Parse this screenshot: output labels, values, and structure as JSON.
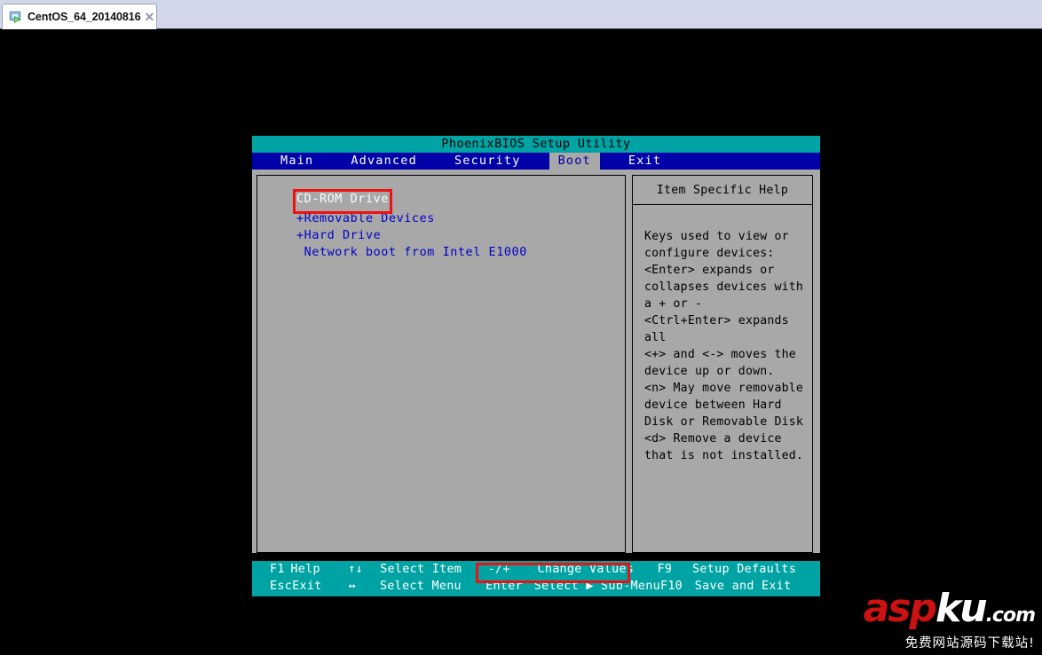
{
  "tab": {
    "title": "CentOS_64_20140816",
    "close_label": "✕",
    "icon": "virtual-machine-icon"
  },
  "bios": {
    "title": "PhoenixBIOS Setup Utility",
    "menu": [
      {
        "label": "Main",
        "selected": false
      },
      {
        "label": "Advanced",
        "selected": false
      },
      {
        "label": "Security",
        "selected": false
      },
      {
        "label": "Boot",
        "selected": true
      },
      {
        "label": "Exit",
        "selected": false
      }
    ],
    "boot_order": [
      {
        "label": "CD-ROM Drive",
        "selected": true,
        "expandable": false
      },
      {
        "label": "+Removable Devices",
        "selected": false,
        "expandable": true
      },
      {
        "label": "+Hard Drive",
        "selected": false,
        "expandable": true
      },
      {
        "label": " Network boot from Intel E1000",
        "selected": false,
        "expandable": false
      }
    ],
    "help": {
      "title": "Item Specific Help",
      "lines": [
        "Keys used to view or",
        "configure devices:",
        "<Enter> expands or",
        "collapses devices with",
        "a + or -",
        "<Ctrl+Enter> expands",
        "all",
        "<+> and <-> moves the",
        "device up or down.",
        "<n> May move removable",
        "device between Hard",
        "Disk or Removable Disk",
        "<d> Remove a device",
        "that is not installed."
      ]
    },
    "footer": {
      "row1": {
        "key1": "F1",
        "label1": "Help",
        "arrow": "↑↓",
        "label2": "Select Item",
        "key2": "-/+",
        "label3": "Change Values",
        "key3": "F9",
        "label4": "Setup Defaults"
      },
      "row2": {
        "key1": "Esc",
        "label1": "Exit",
        "arrow": "↔",
        "label2": "Select Menu",
        "key2": "Enter",
        "label3": "Select ▶ Sub-Menu",
        "key3": "F10",
        "label4": "Save and Exit"
      }
    }
  },
  "annotations": {
    "cdrom_highlight_color": "#ee1111",
    "change_values_highlight_color": "#ee1111"
  },
  "watermark": {
    "brand_part1": "asp",
    "brand_part2": "ku",
    "brand_tld": ".com",
    "subtitle": "免费网站源码下载站!"
  },
  "colors": {
    "bios_teal": "#00a3a3",
    "bios_blue": "#0000a8",
    "bios_gray": "#a8a8a8",
    "bios_text_blue": "#0000c8",
    "tabbar_bg": "#d2d8ea"
  }
}
